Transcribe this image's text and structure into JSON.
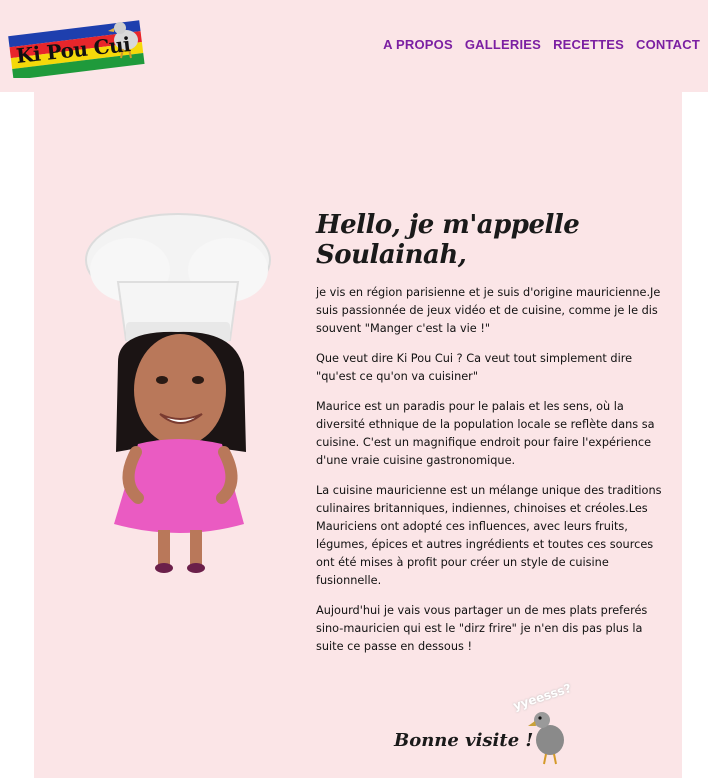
{
  "header": {
    "logo_text": "Ki Pou Cui",
    "nav": [
      "A PROPOS",
      "GALLERIES",
      "RECETTES",
      "CONTACT"
    ]
  },
  "main": {
    "title": "Hello, je m'appelle Soulainah,",
    "paragraphs": [
      "je vis en région parisienne et je suis d'origine mauricienne.Je suis passionnée de jeux vidéo et de cuisine, comme je le dis souvent \"Manger c'est la vie !\"",
      "Que veut dire Ki Pou Cui ? Ca veut tout simplement dire \"qu'est ce qu'on va cuisiner\"",
      "Maurice est un paradis pour le palais et les sens, où la diversité ethnique de la population locale se reflète dans sa cuisine. C'est un magnifique endroit pour faire l'expérience d'une vraie cuisine gastronomique.",
      "La cuisine mauricienne est un mélange unique des traditions culinaires britanniques, indiennes, chinoises et créoles.Les Mauriciens ont adopté ces influences, avec leurs fruits, légumes, épices et autres ingrédients et toutes ces sources ont été mises à profit pour créer un style de cuisine fusionnelle.",
      "Aujourd'hui je vais vous partager un de mes plats preferés sino-mauricien qui est le \"dirz frire\" je n'en dis pas plus la suite ce passe en dessous !"
    ],
    "closing": "Bonne visite !",
    "dodo_caption": "yyeesss?"
  },
  "colors": {
    "background": "#fbe5e7",
    "nav": "#7b1fa2",
    "flag": [
      "#1e3fae",
      "#e8262b",
      "#f5d90a",
      "#1f9a3b"
    ]
  }
}
